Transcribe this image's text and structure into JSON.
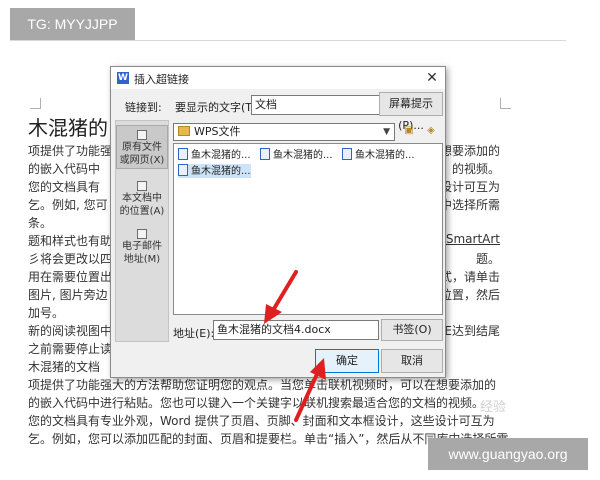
{
  "watermarks": {
    "top": "TG: MYYJJPP",
    "bottom": "www.guangyao.org",
    "logo": "经验"
  },
  "document": {
    "heading": "木混猪的",
    "lines": [
      "项提供了功能强",
      "的嵌入代码中",
      "您的文档具有",
      "乞。例如, 您可",
      "条。",
      "题和样式也有助",
      "彡将会更改以四",
      "用在需要位置出",
      "图片, 图片旁边",
      "加号。",
      "新的阅读视图中",
      "之前需要停止读",
      "木混猪的文档",
      "项提供了功能强大的方法帮助您证明您的观点。当您单击联机视频时，可以在想要添加的",
      "的嵌入代码中进行粘贴。您也可以键入一个关键字以联机搜索最适合您的文档的视频。",
      "您的文档具有专业外观，Word 提供了页眉、页脚、封面和文本框设计，这些设计可互为",
      "乞。例如，您可以添加匹配的封面、页眉和提要栏。单击“插入”，然后从不同库中选择所需"
    ],
    "right_fragments": [
      "想要添加的",
      "的视频。",
      "设计可互为",
      "中选择所需",
      "SmartArt",
      "题。",
      "式，请单击",
      "位置，然后",
      "",
      "E达到结尾"
    ]
  },
  "dialog": {
    "title": "插入超链接",
    "link_to_label": "链接到:",
    "display_text_label": "要显示的文字(T):",
    "display_text_value": "文档",
    "screentip_button": "屏幕提示(P)...",
    "sidebar": [
      {
        "label": "原有文件\n或网页(X)",
        "icon": "globe-file-icon"
      },
      {
        "label": "本文档中\n的位置(A)",
        "icon": "document-place-icon"
      },
      {
        "label": "电子邮件\n地址(M)",
        "icon": "email-icon"
      }
    ],
    "look_in_value": "WPS文件",
    "files": [
      "鱼木混猪的...",
      "鱼木混猪的...",
      "鱼木混猪的...",
      "鱼木混猪的..."
    ],
    "address_label": "地址(E):",
    "address_value": "鱼木混猪的文档4.docx",
    "bookmark_button": "书签(O)",
    "ok_button": "确定",
    "cancel_button": "取消"
  },
  "colors": {
    "arrow": "#e02020",
    "accent": "#0078d7"
  }
}
